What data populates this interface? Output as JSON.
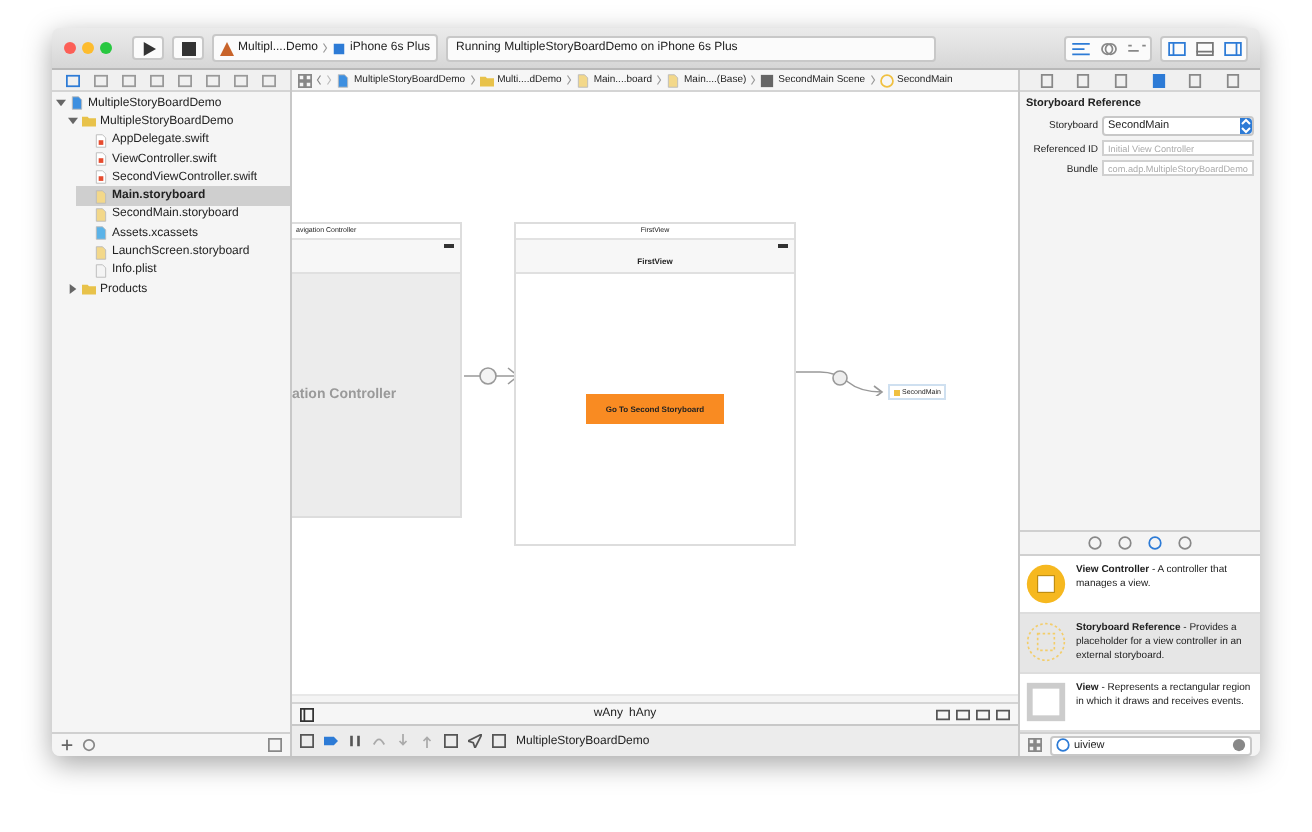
{
  "toolbar": {
    "scheme": "Multipl....Demo",
    "device": "iPhone 6s Plus",
    "status": "Running MultipleStoryBoardDemo on iPhone 6s Plus"
  },
  "jump_bar": [
    {
      "label": "MultipleStoryBoardDemo",
      "kind": "project"
    },
    {
      "label": "Multi....dDemo",
      "kind": "folder"
    },
    {
      "label": "Main....board",
      "kind": "storyboard"
    },
    {
      "label": "Main....(Base)",
      "kind": "storyboard"
    },
    {
      "label": "SecondMain Scene",
      "kind": "scene"
    },
    {
      "label": "SecondMain",
      "kind": "reference"
    }
  ],
  "navigator": [
    {
      "label": "MultipleStoryBoardDemo",
      "kind": "project",
      "expanded": true,
      "selected": false,
      "children": [
        {
          "label": "MultipleStoryBoardDemo",
          "kind": "folder",
          "expanded": true,
          "selected": false,
          "children": [
            {
              "label": "AppDelegate.swift",
              "kind": "swift",
              "selected": false
            },
            {
              "label": "ViewController.swift",
              "kind": "swift",
              "selected": false
            },
            {
              "label": "SecondViewController.swift",
              "kind": "swift",
              "selected": false
            },
            {
              "label": "Main.storyboard",
              "kind": "storyboard",
              "selected": true
            },
            {
              "label": "SecondMain.storyboard",
              "kind": "storyboard",
              "selected": false
            },
            {
              "label": "Assets.xcassets",
              "kind": "assets",
              "selected": false
            },
            {
              "label": "LaunchScreen.storyboard",
              "kind": "storyboard",
              "selected": false
            },
            {
              "label": "Info.plist",
              "kind": "plist",
              "selected": false
            }
          ]
        },
        {
          "label": "Products",
          "kind": "folder",
          "expanded": false,
          "selected": false
        }
      ]
    }
  ],
  "canvas": {
    "nav_scene": {
      "header": "avigation Controller",
      "body": "ation Controller"
    },
    "first_scene": {
      "header": "FirstView",
      "nav_title": "FirstView",
      "button": "Go To Second Storyboard"
    },
    "reference": "SecondMain"
  },
  "size_class": {
    "width": "wAny",
    "height": "hAny"
  },
  "debug_bar": {
    "target": "MultipleStoryBoardDemo"
  },
  "inspector": {
    "title": "Storyboard Reference",
    "fields": [
      {
        "label": "Storyboard",
        "kind": "popup",
        "value": "SecondMain"
      },
      {
        "label": "Referenced ID",
        "kind": "text",
        "placeholder": "Initial View Controller"
      },
      {
        "label": "Bundle",
        "kind": "text",
        "placeholder": "com.adp.MultipleStoryBoardDemo"
      }
    ]
  },
  "library": {
    "items": [
      {
        "text": "**View Controller** - A controller that manages a view.",
        "kind": "controller",
        "selected": false
      },
      {
        "text": "**Storyboard Reference** - Provides a placeholder for a view controller in an external storyboard.",
        "kind": "reference",
        "selected": true
      },
      {
        "text": "**View** - Represents a rectangular region in which it draws and receives events.",
        "kind": "view",
        "selected": false
      }
    ],
    "filter": "uiview"
  }
}
